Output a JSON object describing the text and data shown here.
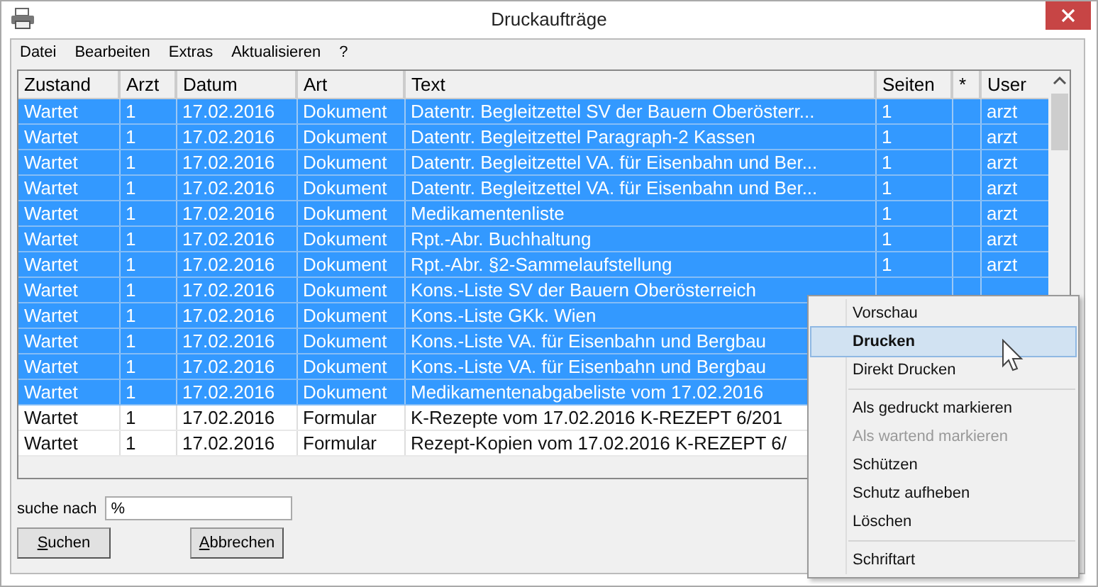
{
  "window": {
    "title": "Druckaufträge"
  },
  "menu_bar": [
    "Datei",
    "Bearbeiten",
    "Extras",
    "Aktualisieren",
    "?"
  ],
  "table": {
    "columns": [
      "Zustand",
      "Arzt",
      "Datum",
      "Art",
      "Text",
      "Seiten",
      "*",
      "User"
    ],
    "rows": [
      {
        "selected": true,
        "cells": [
          "Wartet",
          "1",
          "17.02.2016",
          "Dokument",
          "Datentr. Begleitzettel SV der Bauern Oberösterr...",
          "1",
          "",
          "arzt"
        ]
      },
      {
        "selected": true,
        "cells": [
          "Wartet",
          "1",
          "17.02.2016",
          "Dokument",
          "Datentr. Begleitzettel Paragraph-2 Kassen",
          "1",
          "",
          "arzt"
        ]
      },
      {
        "selected": true,
        "cells": [
          "Wartet",
          "1",
          "17.02.2016",
          "Dokument",
          "Datentr. Begleitzettel VA. für Eisenbahn und Ber...",
          "1",
          "",
          "arzt"
        ]
      },
      {
        "selected": true,
        "cells": [
          "Wartet",
          "1",
          "17.02.2016",
          "Dokument",
          "Datentr. Begleitzettel VA. für Eisenbahn und Ber...",
          "1",
          "",
          "arzt"
        ]
      },
      {
        "selected": true,
        "cells": [
          "Wartet",
          "1",
          "17.02.2016",
          "Dokument",
          "Medikamentenliste",
          "1",
          "",
          "arzt"
        ]
      },
      {
        "selected": true,
        "cells": [
          "Wartet",
          "1",
          "17.02.2016",
          "Dokument",
          "Rpt.-Abr. Buchhaltung",
          "1",
          "",
          "arzt"
        ]
      },
      {
        "selected": true,
        "cells": [
          "Wartet",
          "1",
          "17.02.2016",
          "Dokument",
          "Rpt.-Abr. §2-Sammelaufstellung",
          "1",
          "",
          "arzt"
        ]
      },
      {
        "selected": true,
        "cells": [
          "Wartet",
          "1",
          "17.02.2016",
          "Dokument",
          "Kons.-Liste SV der Bauern Oberösterreich"
        ]
      },
      {
        "selected": true,
        "cells": [
          "Wartet",
          "1",
          "17.02.2016",
          "Dokument",
          "Kons.-Liste GKk. Wien"
        ]
      },
      {
        "selected": true,
        "cells": [
          "Wartet",
          "1",
          "17.02.2016",
          "Dokument",
          "Kons.-Liste VA. für Eisenbahn und Bergbau"
        ]
      },
      {
        "selected": true,
        "cells": [
          "Wartet",
          "1",
          "17.02.2016",
          "Dokument",
          "Kons.-Liste VA. für Eisenbahn und Bergbau"
        ]
      },
      {
        "selected": true,
        "cells": [
          "Wartet",
          "1",
          "17.02.2016",
          "Dokument",
          "Medikamentenabgabeliste vom 17.02.2016"
        ]
      },
      {
        "selected": false,
        "cells": [
          "Wartet",
          "1",
          "17.02.2016",
          "Formular",
          "K-Rezepte vom 17.02.2016 K-REZEPT 6/201"
        ]
      },
      {
        "selected": false,
        "cells": [
          "Wartet",
          "1",
          "17.02.2016",
          "Formular",
          "Rezept-Kopien vom 17.02.2016 K-REZEPT 6/"
        ]
      }
    ]
  },
  "search": {
    "label": "suche nach",
    "value": "%"
  },
  "buttons": [
    {
      "label": "Suchen"
    },
    {
      "label": "Abbrechen"
    }
  ],
  "context_menu": [
    {
      "kind": "item",
      "label": "Vorschau",
      "selected": false,
      "disabled": false,
      "default": false
    },
    {
      "kind": "item",
      "label": "Drucken",
      "selected": true,
      "disabled": false,
      "default": true
    },
    {
      "kind": "item",
      "label": "Direkt Drucken",
      "selected": false,
      "disabled": false,
      "default": false
    },
    {
      "kind": "separator"
    },
    {
      "kind": "item",
      "label": "Als gedruckt markieren",
      "selected": false,
      "disabled": false,
      "default": false
    },
    {
      "kind": "item",
      "label": "Als wartend markieren",
      "selected": false,
      "disabled": true,
      "default": false
    },
    {
      "kind": "item",
      "label": "Schützen",
      "selected": false,
      "disabled": false,
      "default": false
    },
    {
      "kind": "item",
      "label": "Schutz aufheben",
      "selected": false,
      "disabled": false,
      "default": false
    },
    {
      "kind": "item",
      "label": "Löschen",
      "selected": false,
      "disabled": false,
      "default": false
    },
    {
      "kind": "separator"
    },
    {
      "kind": "item",
      "label": "Schriftart",
      "selected": false,
      "disabled": false,
      "default": false
    }
  ]
}
